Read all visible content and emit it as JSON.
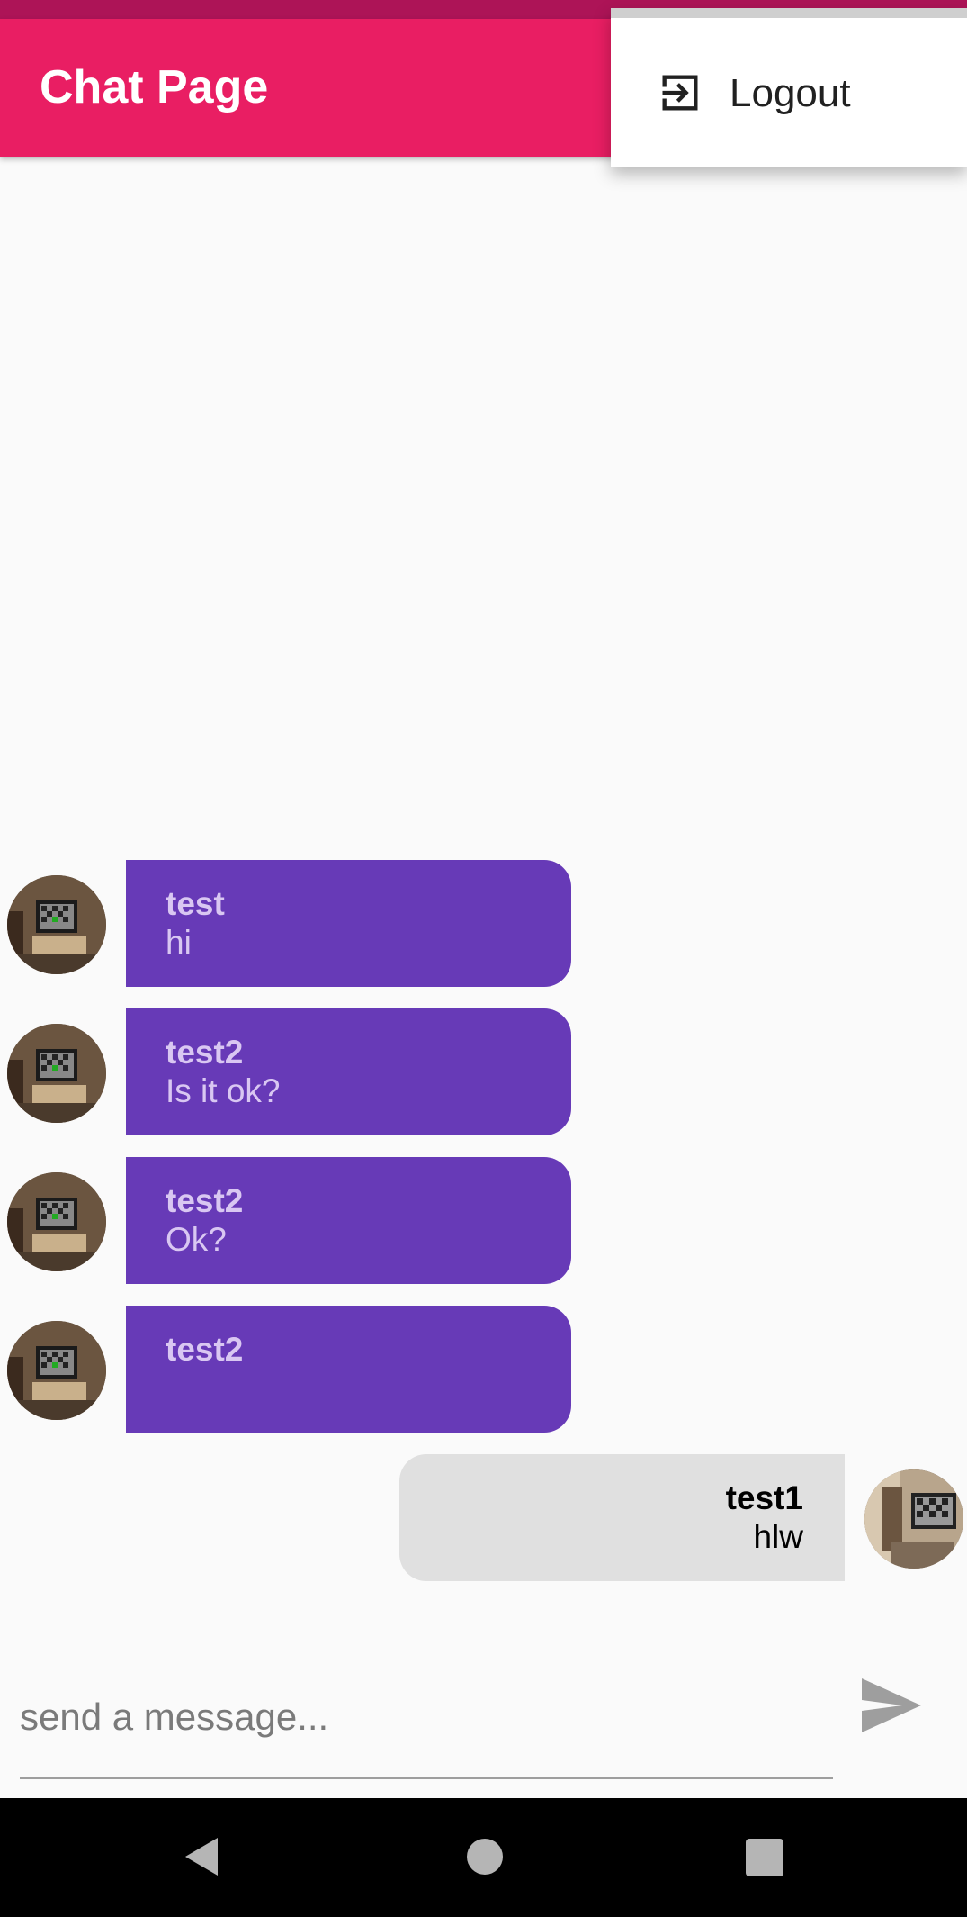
{
  "app_bar": {
    "title": "Chat Page",
    "color": "#e91e63",
    "status_bar_color": "#ad1457"
  },
  "overflow_menu": {
    "items": [
      {
        "label": "Logout",
        "icon": "logout-icon"
      }
    ]
  },
  "messages": [
    {
      "sender": "test",
      "text": "hi",
      "is_self": false
    },
    {
      "sender": "test2",
      "text": "Is it ok?",
      "is_self": false
    },
    {
      "sender": "test2",
      "text": "Ok?",
      "is_self": false
    },
    {
      "sender": "test2",
      "text": "",
      "is_self": false
    },
    {
      "sender": "test1",
      "text": "hlw",
      "is_self": true
    }
  ],
  "composer": {
    "placeholder": "send a message...",
    "send_icon": "send-icon"
  },
  "colors": {
    "other_bubble": "#673ab7",
    "self_bubble": "#e0e0e0"
  },
  "navigation_bar": {
    "buttons": [
      "back-icon",
      "home-icon",
      "recents-icon"
    ]
  }
}
